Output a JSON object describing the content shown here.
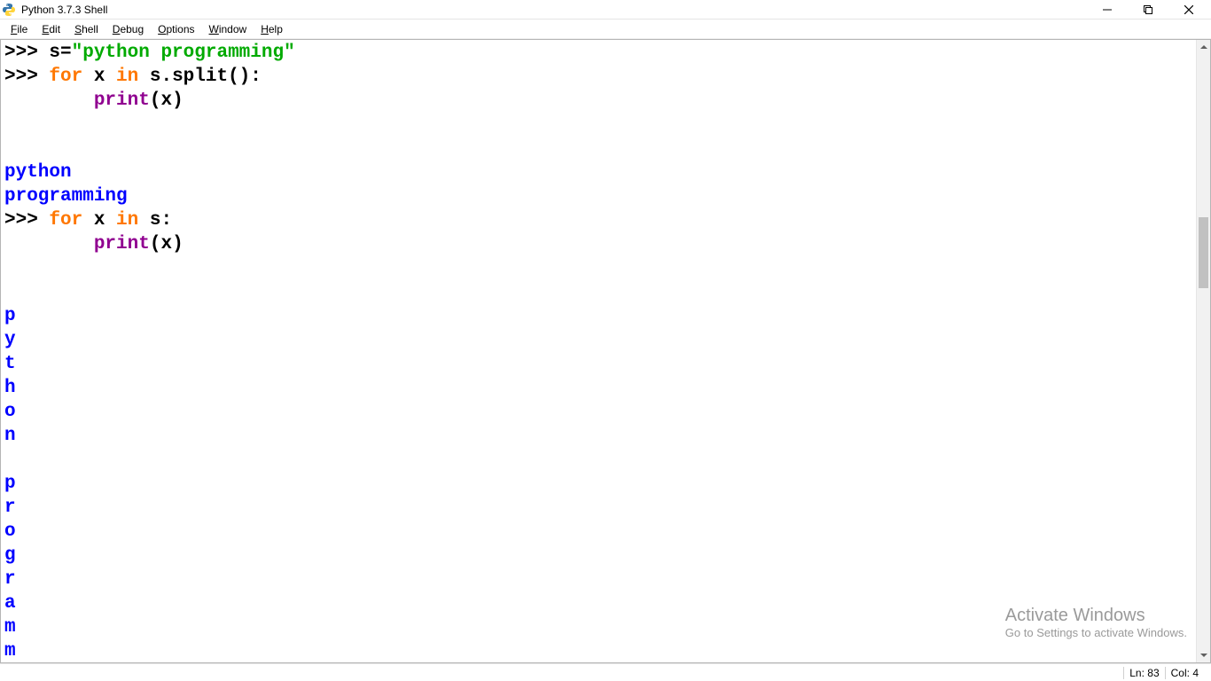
{
  "window": {
    "title": "Python 3.7.3 Shell"
  },
  "menu": {
    "items": [
      {
        "label": "File",
        "ul": "F"
      },
      {
        "label": "Edit",
        "ul": "E"
      },
      {
        "label": "Shell",
        "ul": "S"
      },
      {
        "label": "Debug",
        "ul": "D"
      },
      {
        "label": "Options",
        "ul": "O"
      },
      {
        "label": "Window",
        "ul": "W"
      },
      {
        "label": "Help",
        "ul": "H"
      }
    ]
  },
  "code": {
    "lines": [
      {
        "type": "input",
        "parts": [
          {
            "c": "pr",
            "t": ">>> "
          },
          {
            "c": "nm",
            "t": "s"
          },
          {
            "c": "op",
            "t": "="
          },
          {
            "c": "str",
            "t": "\"python programming\""
          }
        ]
      },
      {
        "type": "input",
        "parts": [
          {
            "c": "pr",
            "t": ">>> "
          },
          {
            "c": "kw",
            "t": "for"
          },
          {
            "c": "nm",
            "t": " x "
          },
          {
            "c": "kw",
            "t": "in"
          },
          {
            "c": "nm",
            "t": " s.split():"
          }
        ]
      },
      {
        "type": "cont",
        "parts": [
          {
            "c": "pr",
            "t": "        "
          },
          {
            "c": "bl",
            "t": "print"
          },
          {
            "c": "op",
            "t": "("
          },
          {
            "c": "nm",
            "t": "x"
          },
          {
            "c": "op",
            "t": ")"
          }
        ]
      },
      {
        "type": "blank",
        "parts": [
          {
            "c": "nm",
            "t": ""
          }
        ]
      },
      {
        "type": "blank",
        "parts": [
          {
            "c": "nm",
            "t": ""
          }
        ]
      },
      {
        "type": "output",
        "parts": [
          {
            "c": "out",
            "t": "python"
          }
        ]
      },
      {
        "type": "output",
        "parts": [
          {
            "c": "out",
            "t": "programming"
          }
        ]
      },
      {
        "type": "input",
        "parts": [
          {
            "c": "pr",
            "t": ">>> "
          },
          {
            "c": "kw",
            "t": "for"
          },
          {
            "c": "nm",
            "t": " x "
          },
          {
            "c": "kw",
            "t": "in"
          },
          {
            "c": "nm",
            "t": " s:"
          }
        ]
      },
      {
        "type": "cont",
        "parts": [
          {
            "c": "pr",
            "t": "        "
          },
          {
            "c": "bl",
            "t": "print"
          },
          {
            "c": "op",
            "t": "("
          },
          {
            "c": "nm",
            "t": "x"
          },
          {
            "c": "op",
            "t": ")"
          }
        ]
      },
      {
        "type": "blank",
        "parts": [
          {
            "c": "nm",
            "t": ""
          }
        ]
      },
      {
        "type": "blank",
        "parts": [
          {
            "c": "nm",
            "t": ""
          }
        ]
      },
      {
        "type": "output",
        "parts": [
          {
            "c": "out",
            "t": "p"
          }
        ]
      },
      {
        "type": "output",
        "parts": [
          {
            "c": "out",
            "t": "y"
          }
        ]
      },
      {
        "type": "output",
        "parts": [
          {
            "c": "out",
            "t": "t"
          }
        ]
      },
      {
        "type": "output",
        "parts": [
          {
            "c": "out",
            "t": "h"
          }
        ]
      },
      {
        "type": "output",
        "parts": [
          {
            "c": "out",
            "t": "o"
          }
        ]
      },
      {
        "type": "output",
        "parts": [
          {
            "c": "out",
            "t": "n"
          }
        ]
      },
      {
        "type": "output",
        "parts": [
          {
            "c": "out",
            "t": " "
          }
        ]
      },
      {
        "type": "output",
        "parts": [
          {
            "c": "out",
            "t": "p"
          }
        ]
      },
      {
        "type": "output",
        "parts": [
          {
            "c": "out",
            "t": "r"
          }
        ]
      },
      {
        "type": "output",
        "parts": [
          {
            "c": "out",
            "t": "o"
          }
        ]
      },
      {
        "type": "output",
        "parts": [
          {
            "c": "out",
            "t": "g"
          }
        ]
      },
      {
        "type": "output",
        "parts": [
          {
            "c": "out",
            "t": "r"
          }
        ]
      },
      {
        "type": "output",
        "parts": [
          {
            "c": "out",
            "t": "a"
          }
        ]
      },
      {
        "type": "output",
        "parts": [
          {
            "c": "out",
            "t": "m"
          }
        ]
      },
      {
        "type": "output",
        "parts": [
          {
            "c": "out",
            "t": "m"
          }
        ]
      }
    ]
  },
  "status": {
    "ln_label": "Ln:",
    "ln": "83",
    "col_label": "Col:",
    "col": "4"
  },
  "watermark": {
    "line1": "Activate Windows",
    "line2": "Go to Settings to activate Windows."
  }
}
